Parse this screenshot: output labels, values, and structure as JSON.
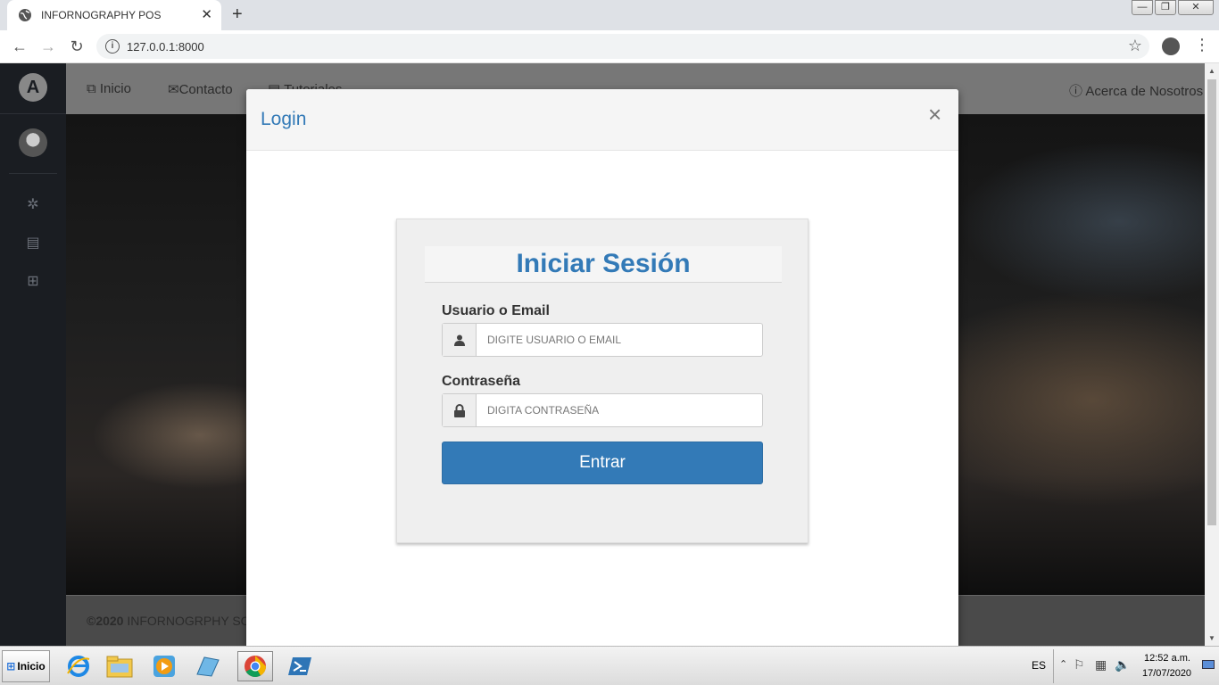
{
  "browser": {
    "tab_title": "INFORNOGRAPHY POS",
    "url": "127.0.0.1:8000"
  },
  "nav": {
    "inicio": "Inicio",
    "contacto": "Contacto",
    "tutoriales": "Tutoriales",
    "acerca": "Acerca de Nosotros"
  },
  "footer": {
    "year": "©2020",
    "company": "INFORNOGRPHY SO"
  },
  "modal": {
    "title": "Login",
    "close": "×"
  },
  "login": {
    "heading": "Iniciar Sesión",
    "user_label": "Usuario o Email",
    "user_placeholder": "DIGITE USUARIO O EMAIL",
    "password_label": "Contraseña",
    "password_placeholder": "DIGITA CONTRASEÑA",
    "submit": "Entrar"
  },
  "taskbar": {
    "start": "Inicio",
    "lang": "ES",
    "time": "12:52 a.m.",
    "date": "17/07/2020"
  },
  "colors": {
    "primary": "#337ab7",
    "sidebar": "#1a1d22"
  }
}
